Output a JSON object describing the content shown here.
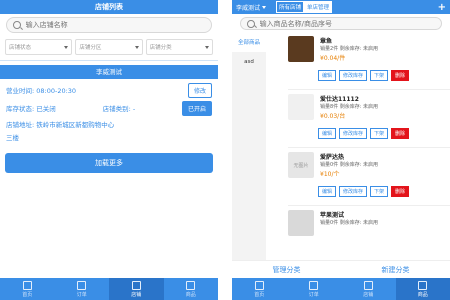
{
  "left": {
    "title": "店铺列表",
    "search_placeholder": "输入店铺名称",
    "filters": [
      "店铺状态",
      "店铺分区",
      "店铺分类"
    ],
    "shop_name": "李威测试",
    "business_hours_label": "营业时间: 08:00-20:30",
    "edit_btn": "修改",
    "status_label": "库存状态: 已关闭",
    "category_label": "店铺类别: -",
    "open_btn": "已开启",
    "address_label": "店铺地址: 铁岭市新城区新都购物中心",
    "address_line2": "三楼",
    "load_more": "加载更多",
    "tabs": [
      "首页",
      "订单",
      "店铺",
      "商品"
    ]
  },
  "right": {
    "store_select": "李威测试",
    "seg1": "所有店铺",
    "seg2": "单店管理",
    "plus": "+",
    "search_placeholder": "输入商品名称/商品序号",
    "categories": [
      "全部商品",
      "asd"
    ],
    "products": [
      {
        "name": "章鱼",
        "stock": "销量2件  剩余库存: 未启用",
        "price": "¥0.04/件"
      },
      {
        "name": "爱仕达11112",
        "stock": "销量8件  剩余库存: 未启用",
        "price": "¥0.03/台"
      },
      {
        "name": "爱萨达热",
        "stock": "销量0件  剩余库存: 未启用",
        "price": "¥10/个"
      },
      {
        "name": "苹果测试",
        "stock": "销量0件  剩余库存: 未启用",
        "price": ""
      }
    ],
    "actions": [
      "编辑",
      "修改库存",
      "下架",
      "删除"
    ],
    "no_image": "无图片",
    "ops": [
      "管理分类",
      "新建分类"
    ],
    "tabs": [
      "首页",
      "订单",
      "店铺",
      "商品"
    ]
  }
}
